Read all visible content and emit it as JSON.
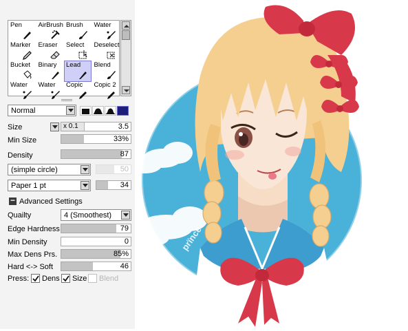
{
  "tools": [
    {
      "label": "Pen",
      "icon": "pen-icon"
    },
    {
      "label": "AirBrush",
      "icon": "airbrush-icon"
    },
    {
      "label": "Brush",
      "icon": "brush-icon"
    },
    {
      "label": "Water",
      "icon": "water-icon"
    },
    {
      "label": "Marker",
      "icon": "marker-icon"
    },
    {
      "label": "Eraser",
      "icon": "eraser-icon"
    },
    {
      "label": "Select",
      "icon": "select-icon"
    },
    {
      "label": "Deselect",
      "icon": "deselect-icon"
    },
    {
      "label": "Bucket",
      "icon": "bucket-icon"
    },
    {
      "label": "Binary",
      "icon": "binary-icon"
    },
    {
      "label": "Lead",
      "icon": "lead-icon",
      "selected": true
    },
    {
      "label": "Blend",
      "icon": "blend-icon"
    },
    {
      "label": "Water",
      "icon": "water-icon"
    },
    {
      "label": "Water",
      "icon": "water-icon"
    },
    {
      "label": "Copic",
      "icon": "copic-icon"
    },
    {
      "label": "Copic 2",
      "icon": "copic-icon"
    }
  ],
  "blend_mode": {
    "value": "Normal"
  },
  "brush_shapes": [
    "square",
    "hard-round",
    "medium-round",
    "soft-round",
    "flat"
  ],
  "size": {
    "label": "Size",
    "multiplier": "x 0.1",
    "value": "3.5"
  },
  "min_size": {
    "label": "Min Size",
    "value": "33%",
    "fill_fraction": 0.33
  },
  "density": {
    "label": "Density",
    "value": "87",
    "fill_fraction": 0.87
  },
  "brush_shape_select": {
    "value": "(simple circle)",
    "strength": "50"
  },
  "brush_texture_select": {
    "value": "Paper 1 pt",
    "strength": "34",
    "strength_fraction": 0.34
  },
  "advanced": {
    "toggle": "−",
    "label": "Advanced Settings"
  },
  "quality": {
    "label": "Quailty",
    "value": "4 (Smoothest)"
  },
  "edge_hardness": {
    "label": "Edge Hardness",
    "value": "79",
    "fill_fraction": 0.79
  },
  "min_density": {
    "label": "Min Density",
    "value": "0",
    "fill_fraction": 0
  },
  "max_dens_prs": {
    "label": "Max Dens Prs.",
    "value": "85%",
    "fill_fraction": 0.85
  },
  "hard_soft": {
    "label": "Hard <-> Soft",
    "value": "46",
    "fill_fraction": 0.46
  },
  "press": {
    "label": "Press:",
    "dens": "Dens",
    "size": "Size",
    "blend": "Blend"
  },
  "artwork": {
    "signature": "prïnce"
  },
  "colors": {
    "panel_bg": "#f3f3f3",
    "selected_tool": "#cfcff7",
    "sky_blue": "#4ab1d8",
    "hair": "#f4cf8f",
    "bow_red": "#d8394a",
    "sailor_blue": "#3d9dcf"
  }
}
